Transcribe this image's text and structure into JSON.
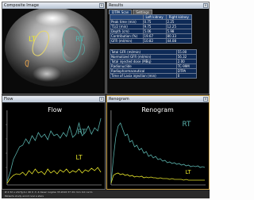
{
  "colors": {
    "rt": "#59b0aa",
    "lt": "#e8e62a",
    "roi_lt": "#e8d86c",
    "roi_rt": "#56a9a3",
    "table_bg": "#0e2a56",
    "renogram_frame": "#c9a24a"
  },
  "composite": {
    "title": "Composite Image",
    "label_lt": "LT",
    "label_rt": "RT"
  },
  "results": {
    "title": "Results",
    "tabs": [
      "DTPA Scan",
      "Settings"
    ],
    "table1": {
      "headers": [
        "",
        "Left kidney",
        "Right kidney"
      ],
      "rows": [
        [
          "Peak time (min)",
          "0.75",
          "2.25"
        ],
        [
          "T1/2 (min)",
          "9.75",
          "12.25"
        ],
        [
          "Depth (cm)",
          "5.06",
          "5.98"
        ],
        [
          "Contribution (%)",
          "19.67",
          "80.33"
        ],
        [
          "GFR (ml/min)",
          "10.82",
          "44.08"
        ]
      ]
    },
    "table2": {
      "rows": [
        [
          "Total GFR (ml/min)",
          "55.00"
        ],
        [
          "Normalized GFR (ml/min)",
          "56.32"
        ],
        [
          "Total injected dose (MBq)",
          "2.00"
        ],
        [
          "Radionuclide",
          "TC-99M"
        ],
        [
          "Radiopharmaceutical",
          "DTPA"
        ],
        [
          "Time of Lasix injection (min)",
          "0"
        ]
      ]
    }
  },
  "flow": {
    "title": "Flow",
    "heading": "Flow",
    "label_rt": "RT",
    "label_lt": "LT"
  },
  "renogram": {
    "title": "Renogram",
    "heading": "Renogram",
    "label_rt": "RT",
    "label_lt": "LT"
  },
  "statusbar": {
    "line1": "Ø 4 32 u vtcrfg 4.n 40 0 .h .4 deser ruiglow 33.2016 37 dm mrn 4.0 cw to",
    "line2": "Patients study enroll ncel a stars"
  }
}
